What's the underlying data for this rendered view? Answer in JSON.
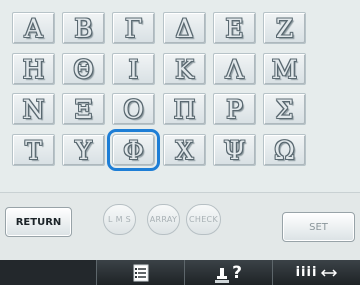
{
  "grid": {
    "letters": [
      "Α",
      "Β",
      "Γ",
      "Δ",
      "Ε",
      "Ζ",
      "Η",
      "Θ",
      "Ι",
      "Κ",
      "Λ",
      "Μ",
      "Ν",
      "Ξ",
      "Ο",
      "Π",
      "Ρ",
      "Σ",
      "Τ",
      "Υ",
      "Φ",
      "Χ",
      "Ψ",
      "Ω"
    ],
    "selected_letter": "Φ"
  },
  "controls": {
    "return_label": "RETURN",
    "lms_label": "L M S",
    "array_label": "ARRAY",
    "check_label": "CHECK",
    "set_label": "SET"
  },
  "bottom_bar": {
    "help_label": "?",
    "spacing_label": "iiii",
    "icons": [
      "checklist-icon",
      "sewing-machine-help-icon",
      "letter-spacing-icon"
    ]
  },
  "colors": {
    "selection": "#1e7ed6",
    "background": "#e6ecec",
    "bottom_bar": "#23282c"
  }
}
